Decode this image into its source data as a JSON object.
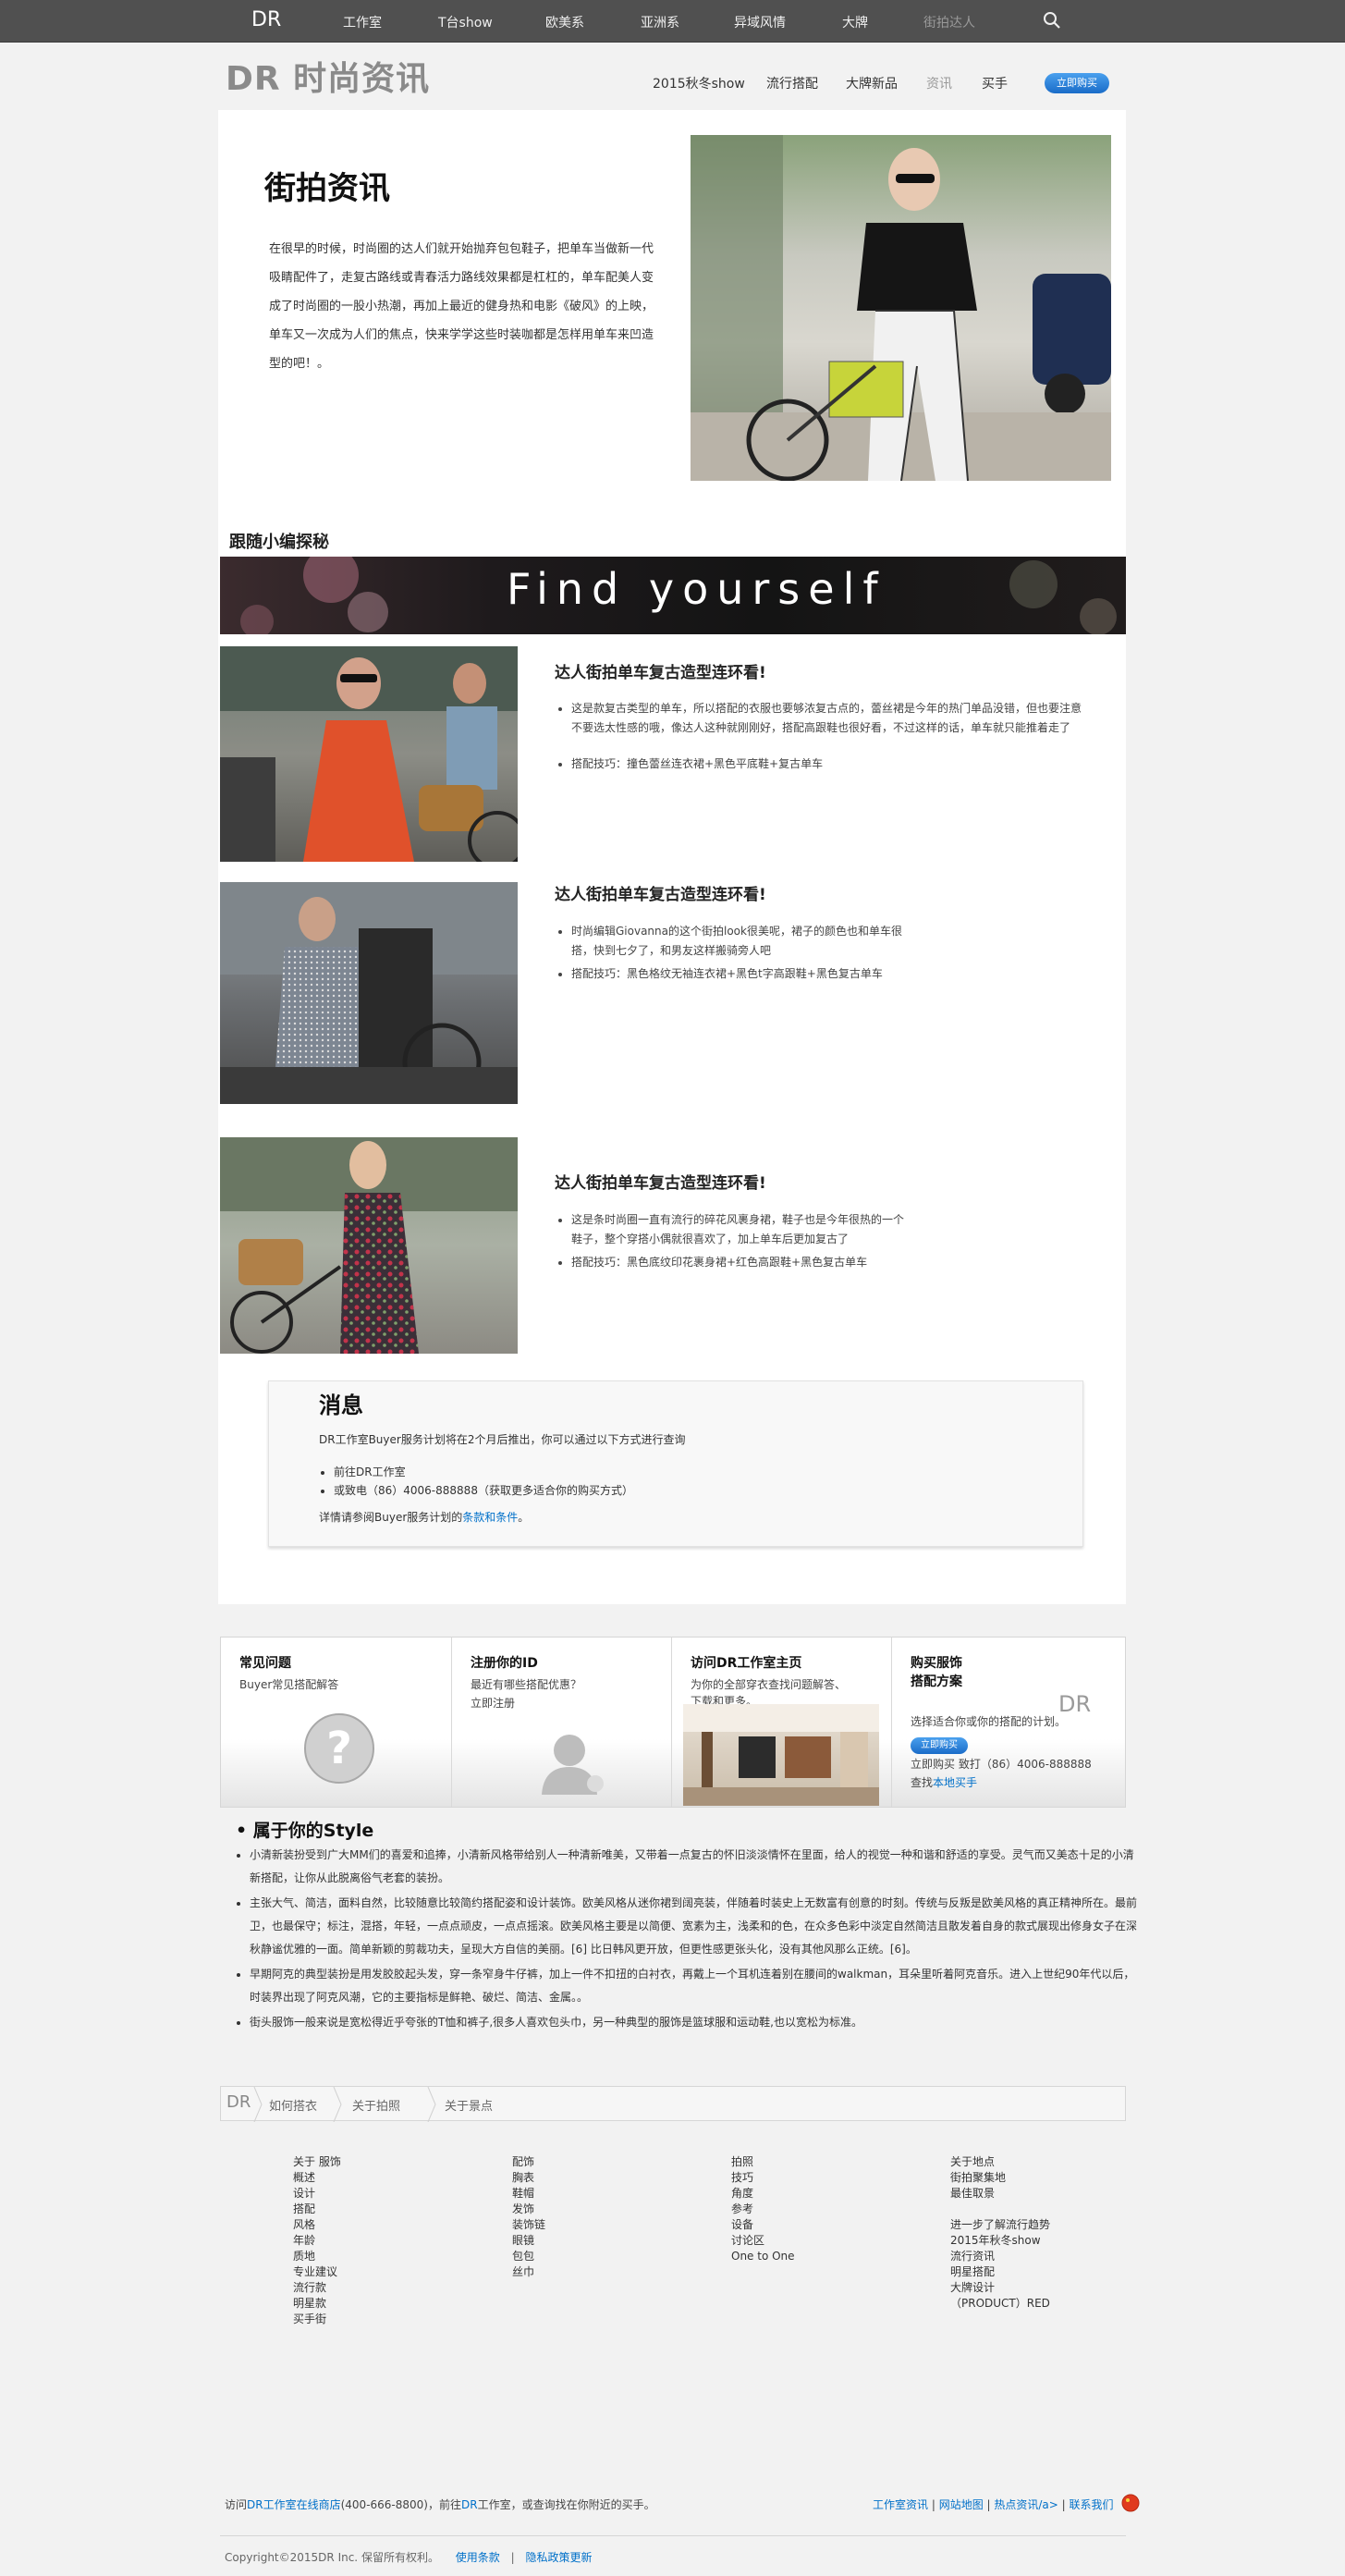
{
  "topnav": {
    "logo": "DR",
    "items": [
      "工作室",
      "T台show",
      "欧美系",
      "亚洲系",
      "异域风情",
      "大牌",
      "街拍达人"
    ]
  },
  "subheader": {
    "brand": "DR 时尚资讯",
    "links": [
      "2015秋冬show",
      "流行搭配",
      "大牌新品",
      "资讯",
      "买手"
    ],
    "buy": "立即购买"
  },
  "hero": {
    "title": "街拍资讯",
    "text": "在很早的时候，时尚圈的达人们就开始抛弃包包鞋子，把单车当做新一代吸睛配件了，走复古路线或青春活力路线效果都是杠杠的，单车配美人变成了时尚圈的一股小热潮，再加上最近的健身热和电影《破风》的上映，单车又一次成为人们的焦点，快来学学这些时装咖都是怎样用单车来凹造型的吧！。"
  },
  "section_label": "跟随小编探秘",
  "banner_text": "Find  yourself",
  "items": [
    {
      "title": "达人街拍单车复古造型连环看!",
      "bullets": [
        "这是款复古类型的单车，所以搭配的衣服也要够浓复古点的，蕾丝裙是今年的热门单品没错，但也要注意不要选太性感的哦，像达人这种就刚刚好，搭配高跟鞋也很好看，不过这样的话，单车就只能推着走了",
        "搭配技巧：撞色蕾丝连衣裙+黑色平底鞋+复古单车"
      ]
    },
    {
      "title": "达人街拍单车复古造型连环看!",
      "bullets": [
        "时尚编辑Giovanna的这个街拍look很美呢，裙子的颜色也和单车很搭，快到七夕了，和男友这样搬骑旁人吧",
        "搭配技巧：黑色格纹无袖连衣裙+黑色t字高跟鞋+黑色复古单车"
      ]
    },
    {
      "title": "达人街拍单车复古造型连环看!",
      "bullets": [
        "这是条时尚圈一直有流行的碎花风裹身裙，鞋子也是今年很热的一个鞋子，整个穿搭小偶就很喜欢了，加上单车后更加复古了",
        "搭配技巧：黑色底纹印花裹身裙+红色高跟鞋+黑色复古单车"
      ]
    }
  ],
  "message": {
    "title": "消息",
    "intro": "DR工作室Buyer服务计划将在2个月后推出，你可以通过以下方式进行查询",
    "list": [
      "前往DR工作室",
      "或致电（86）4006-888888（获取更多适合你的购买方式）"
    ],
    "footer_prefix": "详情请参阅Buyer服务计划的",
    "footer_link": "条款和条件",
    "footer_suffix": "。"
  },
  "boxes": [
    {
      "title": "常见问题",
      "sub": "Buyer常见搭配解答"
    },
    {
      "title": "注册你的ID",
      "sub": "最近有哪些搭配优惠？",
      "link": "立即注册"
    },
    {
      "title": "访问DR工作室主页",
      "sub": "为你的全部穿衣查找问题解答、下载和更多。"
    },
    {
      "title": "购买服饰\n搭配方案",
      "sub": "选择适合你或你的搭配的计划。",
      "button": "立即购买",
      "line1": "立即购买 致打（86）4006-888888",
      "line2_prefix": "查找",
      "line2_link": "本地买手",
      "logo": "DR"
    }
  ],
  "style": {
    "title": "属于你的Style",
    "paragraphs": [
      "小清新装扮受到广大MM们的喜爱和追捧，小清新风格带给别人一种清新唯美，又带着一点复古的怀旧淡淡情怀在里面，给人的视觉一种和谐和舒适的享受。灵气而又美态十足的小清新搭配，让你从此脱离俗气老套的装扮。",
      "主张大气、简洁，面料自然，比较随意比较简约搭配姿和设计装饰。欧美风格从迷你裙到阔亮装，伴随着时装史上无数富有创意的时刻。传统与反叛是欧美风格的真正精神所在。最前卫，也最保守；标注，混搭，年轻，一点点顽皮，一点点摇滚。欧美风格主要是以简便、宽素为主，浅柔和的色，在众多色彩中淡定自然简洁且散发着自身的款式展现出修身女子在深秋静谧优雅的一面。简单新颖的剪裁功夫，呈现大方自信的美丽。[6] 比日韩风更开放，但更性感更张头化，没有其他风那么正统。[6]。",
      "早期阿克的典型装扮是用发胶胶起头发，穿一条窄身牛仔裤，加上一件不扣扭的白衬衣，再戴上一个耳机连着别在腰间的walkman，耳朵里听着阿克音乐。进入上世纪90年代以后，时装界出现了阿克风潮，它的主要指标是鲜艳、破烂、简洁、金属。。",
      "街头服饰一般来说是宽松得近乎夸张的T恤和裤子,很多人喜欢包头巾，另一种典型的服饰是篮球服和运动鞋,也以宽松为标准。"
    ]
  },
  "breadcrumb": [
    "DR",
    "如何搭衣",
    "关于拍照",
    "关于景点"
  ],
  "footer_cols": [
    [
      "关于 服饰",
      "概述",
      "设计",
      "搭配",
      "风格",
      "年龄",
      "质地",
      "专业建议",
      "流行款",
      "明星款",
      "买手街"
    ],
    [
      "配饰",
      "胸表",
      "鞋帽",
      "发饰",
      "装饰链",
      "眼镜",
      "包包",
      "丝巾"
    ],
    [
      "拍照",
      "技巧",
      "角度",
      "参考",
      "设备",
      "讨论区",
      "One to One"
    ],
    [
      "关于地点",
      "街拍聚集地",
      "最佳取景",
      "",
      "进一步了解流行趋势",
      "2015年秋冬show",
      "流行资讯",
      "明星搭配",
      "大牌设计",
      "（PRODUCT）RED"
    ]
  ],
  "bottom": {
    "left_parts": [
      "访问",
      "DR工作室在线商店",
      "(400-666-8800)，前往",
      "DR",
      "工作室，或查询找在你附近的买手。"
    ],
    "right_links": [
      "工作室资讯",
      "网站地图",
      "热点资讯/a>",
      "联系我们"
    ],
    "copyright": "Copyright©2015DR Inc. 保留所有权利。",
    "legal_links": [
      "使用条款",
      "隐私政策更新"
    ]
  },
  "colors": {
    "accent": "#0070c9",
    "topnav": "#505050",
    "background": "#f2f2f2"
  }
}
